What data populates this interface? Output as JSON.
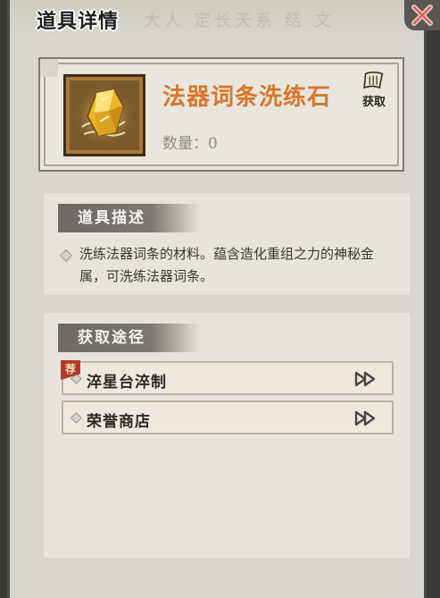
{
  "header": {
    "title": "道具详情",
    "faint_backdrop_text": "大人 定长天系 结 文"
  },
  "item": {
    "name": "法器词条洗练石",
    "count_label": "数量：0",
    "acquire_label": "获取",
    "icon": "gold-crystal-icon",
    "name_color": "#d9762a"
  },
  "description": {
    "section_label": "道具描述",
    "text": "洗练法器词条的材料。蕴含造化重组之力的神秘金属，可洗练法器词条。"
  },
  "sources": {
    "section_label": "获取途径",
    "items": [
      {
        "label": "淬星台淬制",
        "recommended": true,
        "badge": "荐"
      },
      {
        "label": "荣誉商店",
        "recommended": false
      }
    ]
  }
}
